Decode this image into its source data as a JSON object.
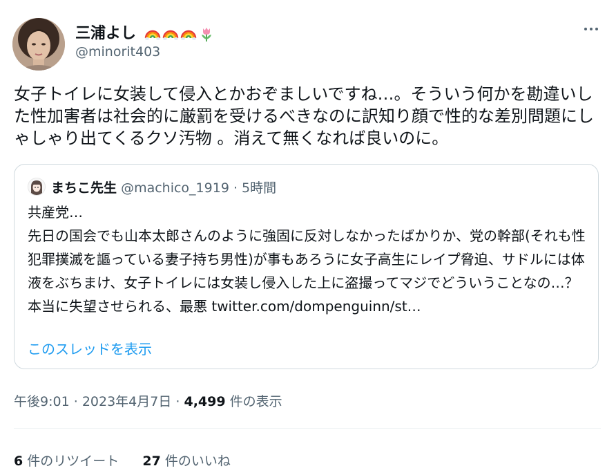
{
  "author": {
    "display_name": "三浦よし",
    "emojis": [
      "rainbow-icon",
      "rainbow-icon",
      "rainbow-icon",
      "tulip-icon"
    ],
    "handle": "@minorit403"
  },
  "tweet": {
    "text": "女子トイレに女装して侵入とかおぞましいですね…。そういう何かを勘違いした性加害者は社会的に厳罰を受けるべきなのに訳知り顔で性的な差別問題にしゃしゃり出てくるクソ汚物 。消えて無くなれば良いのに。"
  },
  "quote": {
    "display_name": "まちこ先生",
    "handle": "@machico_1919",
    "separator": "·",
    "time": "5時間",
    "text": "共産党…\n先日の国会でも山本太郎さんのように強固に反対しなかったばかりか、党の幹部(それも性犯罪撲滅を謳っている妻子持ち男性)が事もあろうに女子高生にレイプ脅迫、サドルには体液をぶちまけ、女子トイレには女装し侵入した上に盗撮ってマジでどういうことなの…？\n本当に失望させられる、最悪 twitter.com/dompenguinn/st…",
    "show_thread": "このスレッドを表示"
  },
  "meta": {
    "time": "午後9:01",
    "sep1": "·",
    "date": "2023年4月7日",
    "sep2": "·",
    "views": "4,499",
    "views_label": "件の表示"
  },
  "stats": {
    "retweets": "6",
    "retweets_label": "件のリツイート",
    "likes": "27",
    "likes_label": "件のいいね"
  },
  "colors": {
    "text": "#0f1419",
    "secondary": "#536471",
    "link": "#1d9bf0",
    "border": "#cfd9de"
  }
}
